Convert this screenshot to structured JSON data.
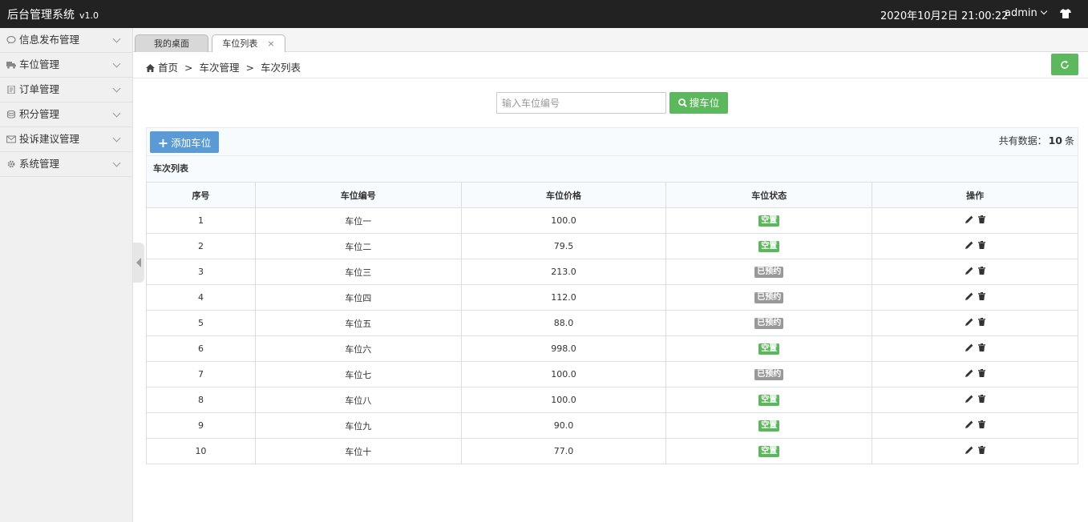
{
  "header": {
    "title": "后台管理系统",
    "version": "v1.0",
    "datetime": "2020年10月2日 21:00:22",
    "user": "admin"
  },
  "sidebar": {
    "items": [
      {
        "label": "信息发布管理",
        "icon": "chat-icon"
      },
      {
        "label": "车位管理",
        "icon": "truck-icon"
      },
      {
        "label": "订单管理",
        "icon": "document-icon"
      },
      {
        "label": "积分管理",
        "icon": "database-icon"
      },
      {
        "label": "投诉建议管理",
        "icon": "envelope-icon"
      },
      {
        "label": "系统管理",
        "icon": "gear-icon"
      }
    ]
  },
  "tabs": [
    {
      "label": "我的桌面"
    },
    {
      "label": "车位列表",
      "close": "×"
    }
  ],
  "breadcrumb": {
    "home": "首页",
    "sep": ">",
    "level1": "车次管理",
    "level2": "车次列表"
  },
  "search": {
    "placeholder": "输入车位编号",
    "button_label": "搜车位"
  },
  "toolbar": {
    "add_label": "添加车位",
    "count_prefix": "共有数据：",
    "count_value": "10",
    "count_suffix": "条"
  },
  "table": {
    "title": "车次列表",
    "headers": [
      "序号",
      "车位编号",
      "车位价格",
      "车位状态",
      "操作"
    ],
    "rows": [
      {
        "no": "1",
        "code": "车位一",
        "price": "100.0",
        "status": "空置",
        "free": true
      },
      {
        "no": "2",
        "code": "车位二",
        "price": "79.5",
        "status": "空置",
        "free": true
      },
      {
        "no": "3",
        "code": "车位三",
        "price": "213.0",
        "status": "已预约",
        "free": false
      },
      {
        "no": "4",
        "code": "车位四",
        "price": "112.0",
        "status": "已预约",
        "free": false
      },
      {
        "no": "5",
        "code": "车位五",
        "price": "88.0",
        "status": "已预约",
        "free": false
      },
      {
        "no": "6",
        "code": "车位六",
        "price": "998.0",
        "status": "空置",
        "free": true
      },
      {
        "no": "7",
        "code": "车位七",
        "price": "100.0",
        "status": "已预约",
        "free": false
      },
      {
        "no": "8",
        "code": "车位八",
        "price": "100.0",
        "status": "空置",
        "free": true
      },
      {
        "no": "9",
        "code": "车位九",
        "price": "90.0",
        "status": "空置",
        "free": true
      },
      {
        "no": "10",
        "code": "车位十",
        "price": "77.0",
        "status": "空置",
        "free": true
      }
    ]
  },
  "colors": {
    "header_bg": "#222222",
    "green": "#5cb85c",
    "blue": "#5b9bd5",
    "booked_gray": "#999999"
  }
}
